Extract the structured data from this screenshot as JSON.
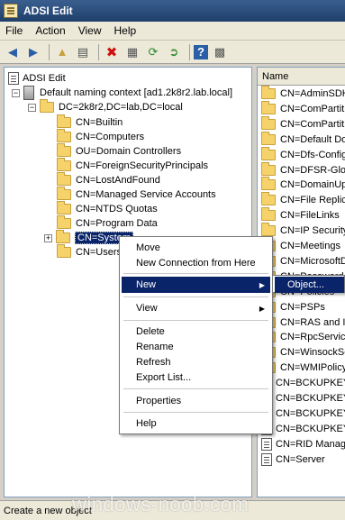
{
  "window": {
    "title": "ADSI Edit",
    "icon": "adsi-edit-icon"
  },
  "menubar": [
    {
      "label": "File",
      "accel": "F"
    },
    {
      "label": "Action",
      "accel": "A"
    },
    {
      "label": "View",
      "accel": "V"
    },
    {
      "label": "Help",
      "accel": "H"
    }
  ],
  "toolbar": [
    {
      "icon": "back-arrow-icon"
    },
    {
      "icon": "forward-arrow-icon"
    },
    {
      "icon": "up-folder-icon"
    },
    {
      "icon": "show-hide-tree-icon"
    },
    {
      "icon": "delete-icon"
    },
    {
      "icon": "properties-icon"
    },
    {
      "icon": "refresh-icon"
    },
    {
      "icon": "export-list-icon"
    },
    {
      "icon": "help-icon"
    },
    {
      "icon": "console-pane-icon"
    }
  ],
  "tree": {
    "root": "ADSI Edit",
    "naming_context": "Default naming context [ad1.2k8r2.lab.local]",
    "domain": "DC=2k8r2,DC=lab,DC=local",
    "children": [
      "CN=Builtin",
      "CN=Computers",
      "OU=Domain Controllers",
      "CN=ForeignSecurityPrincipals",
      "CN=LostAndFound",
      "CN=Managed Service Accounts",
      "CN=NTDS Quotas",
      "CN=Program Data",
      "CN=System",
      "CN=Users"
    ],
    "selected": "CN=System"
  },
  "list": {
    "header": "Name",
    "rows": [
      "CN=AdminSDHo",
      "CN=ComPartitio",
      "CN=ComPartitio",
      "CN=Default Dom",
      "CN=Dfs-Configu",
      "CN=DFSR-Globa",
      "CN=DomainUpd",
      "CN=File Replica",
      "CN=FileLinks",
      "CN=IP Security",
      "CN=Meetings",
      "CN=MicrosoftDN",
      "CN=Password S",
      "CN=Policies",
      "CN=PSPs",
      "CN=RAS and IA",
      "CN=RpcService",
      "CN=WinsockSer",
      "CN=WMIPolicy",
      "CN=BCKUPKEY_",
      "CN=BCKUPKEY_",
      "CN=BCKUPKEY_",
      "CN=BCKUPKEY_",
      "CN=RID Manag",
      "CN=Server"
    ]
  },
  "context_menu": {
    "items": [
      "Move",
      "New Connection from Here",
      "New",
      "View",
      "Delete",
      "Rename",
      "Refresh",
      "Export List...",
      "Properties",
      "Help"
    ],
    "highlighted": "New"
  },
  "submenu": {
    "items": [
      "Object..."
    ]
  },
  "status": {
    "text": "Create a new object"
  },
  "watermark": "windows-noob.com",
  "colors": {
    "selection": "#0a246a",
    "titlebar": "#1f3f6b",
    "folder": "#f6d26b"
  }
}
